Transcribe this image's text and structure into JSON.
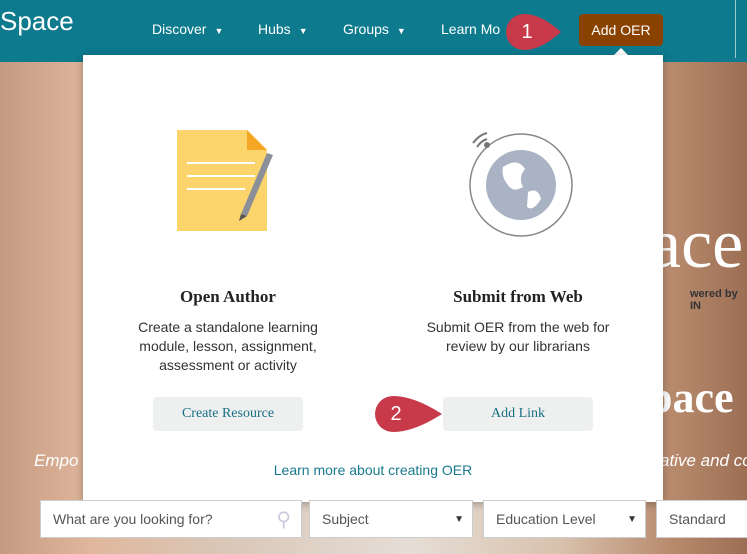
{
  "header": {
    "logo": "Space",
    "nav": [
      {
        "label": "Discover"
      },
      {
        "label": "Hubs"
      },
      {
        "label": "Groups"
      },
      {
        "label": "Learn Mo"
      }
    ],
    "add_oer": "Add OER",
    "brand_color": "#0e7a8e",
    "button_color": "#8a4200"
  },
  "hero": {
    "title_fragment": "ace",
    "powered": "wered by IN",
    "title2_fragment": "pace",
    "tagline_left": "Empo",
    "tagline_right": "ative and co"
  },
  "popup": {
    "open_author": {
      "title": "Open Author",
      "description": "Create a standalone learning module, lesson, assignment, assessment or activity",
      "button": "Create Resource",
      "icon": "document-pencil-icon"
    },
    "submit_web": {
      "title": "Submit from Web",
      "description": "Submit OER from the web for review by our librarians",
      "button": "Add Link",
      "icon": "globe-icon"
    },
    "learn_more": "Learn more about creating OER"
  },
  "search": {
    "placeholder": "What are you looking for?",
    "subject": "Subject",
    "education_level": "Education Level",
    "standard": "Standard"
  },
  "callouts": [
    {
      "number": "1"
    },
    {
      "number": "2"
    }
  ],
  "callout_color": "#c8394a"
}
